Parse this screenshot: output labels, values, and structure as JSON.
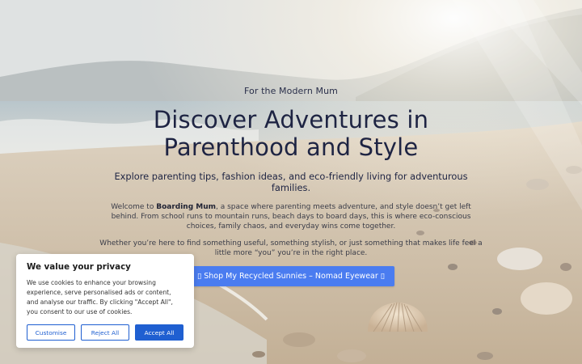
{
  "hero": {
    "eyebrow": "For the Modern Mum",
    "headline_line1": "Discover Adventures in",
    "headline_line2": "Parenthood and Style",
    "subheadline": "Explore parenting tips, fashion ideas, and eco-friendly living for adventurous families.",
    "intro_prefix": "Welcome to ",
    "intro_brand": "Boarding Mum",
    "intro_suffix": ", a space where parenting meets adventure, and style doesn’t get left behind. From school runs to mountain runs, beach days to board days, this is where eco-conscious choices, family chaos, and everyday wins come together.",
    "second_paragraph": "Whether you’re here to find something useful, something stylish, or just something that makes life feel a little more “you” you’re in the right place.",
    "cta_label": "▯ Shop My Recycled Sunnies – Nomad Eyewear ▯"
  },
  "cookie_banner": {
    "title": "We value your privacy",
    "text": "We use cookies to enhance your browsing experience, serve personalised ads or content, and analyse our traffic. By clicking \"Accept All\", you consent to our use of cookies.",
    "customise_label": "Customise",
    "reject_label": "Reject All",
    "accept_label": "Accept All"
  },
  "colors": {
    "cta_blue": "#4a7cf0",
    "cookie_blue": "#1f5fd1",
    "headline_navy": "#1e2443"
  },
  "background": "beach-photo-with-seashells"
}
